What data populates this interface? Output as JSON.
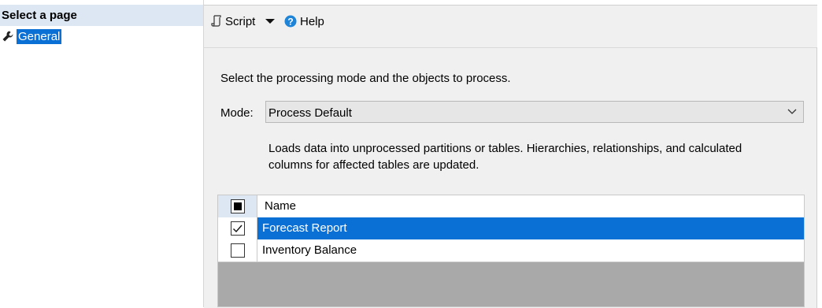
{
  "left_panel": {
    "header": "Select a page",
    "items": [
      {
        "label": "General",
        "icon": "wrench-icon",
        "selected": true
      }
    ]
  },
  "toolbar": {
    "script_label": "Script",
    "help_label": "Help"
  },
  "main": {
    "instruction": "Select the processing mode and the objects to process.",
    "mode_label": "Mode:",
    "mode_value": "Process Default",
    "description": "Loads data into unprocessed partitions or tables. Hierarchies, relationships, and calculated columns for affected tables are updated.",
    "table": {
      "header_name": "Name",
      "header_checkbox_state": "indeterminate",
      "rows": [
        {
          "name": "Forecast Report",
          "checked": true,
          "selected": true
        },
        {
          "name": "Inventory Balance",
          "checked": false,
          "selected": false
        }
      ]
    }
  },
  "colors": {
    "selection": "#0b70d6",
    "header_bg": "#dde7f3",
    "panel_bg": "#f0f0f0",
    "grid_empty": "#a9a9a9",
    "help_icon": "#1d84d8"
  }
}
